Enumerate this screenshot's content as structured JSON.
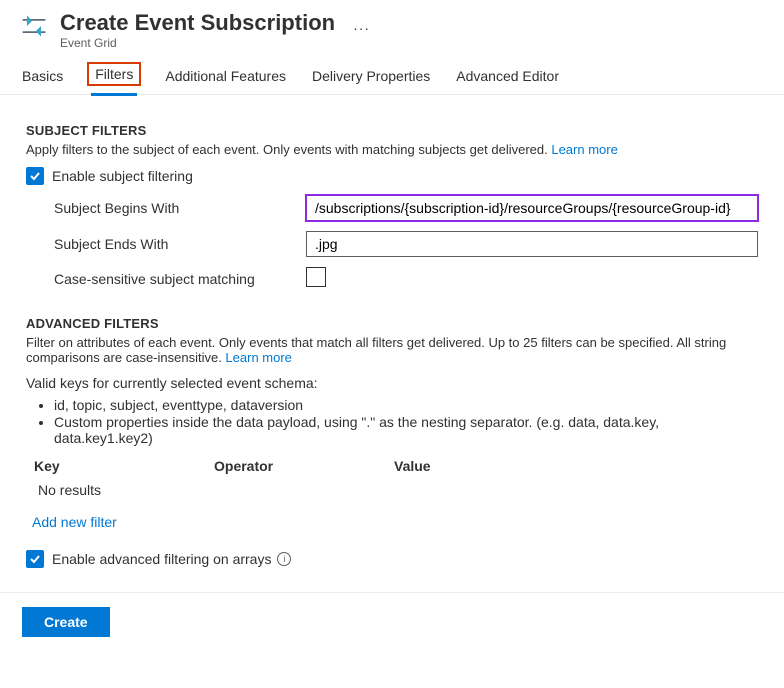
{
  "header": {
    "title": "Create Event Subscription",
    "subtitle": "Event Grid"
  },
  "tabs": {
    "basics": "Basics",
    "filters": "Filters",
    "additional": "Additional Features",
    "delivery": "Delivery Properties",
    "advanced": "Advanced Editor"
  },
  "subjectFilters": {
    "title": "SUBJECT FILTERS",
    "helpText": "Apply filters to the subject of each event. Only events with matching subjects get delivered. ",
    "learnMore": "Learn more",
    "enableLabel": "Enable subject filtering",
    "beginsWithLabel": "Subject Begins With",
    "beginsWithValue": "/subscriptions/{subscription-id}/resourceGroups/{resourceGroup-id}",
    "endsWithLabel": "Subject Ends With",
    "endsWithValue": ".jpg",
    "caseSensitiveLabel": "Case-sensitive subject matching"
  },
  "advancedFilters": {
    "title": "ADVANCED FILTERS",
    "helpText": "Filter on attributes of each event. Only events that match all filters get delivered. Up to 25 filters can be specified. All string comparisons are case-insensitive. ",
    "learnMore": "Learn more",
    "validKeysIntro": "Valid keys for currently selected event schema:",
    "validKeys1": "id, topic, subject, eventtype, dataversion",
    "validKeys2": "Custom properties inside the data payload, using \".\" as the nesting separator. (e.g. data, data.key, data.key1.key2)",
    "colKey": "Key",
    "colOperator": "Operator",
    "colValue": "Value",
    "noResults": "No results",
    "addNew": "Add new filter",
    "enableArraysLabel": "Enable advanced filtering on arrays"
  },
  "footer": {
    "create": "Create"
  }
}
